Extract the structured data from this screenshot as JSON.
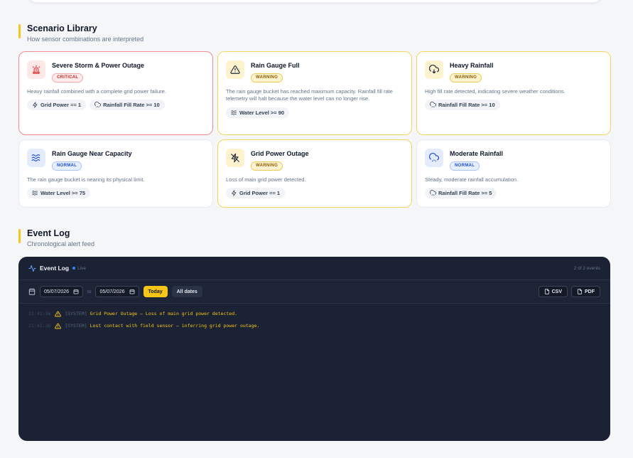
{
  "scenario_library": {
    "title": "Scenario Library",
    "subtitle": "How sensor combinations are interpreted",
    "cards": [
      {
        "title": "Severe Storm & Power Outage",
        "badge": "CRITICAL",
        "icon": "siren-icon",
        "desc": "Heavy rainfall combined with a complete grid power failure.",
        "chips": [
          "Grid Power == 1",
          "Rainfall Fill Rate >= 10"
        ]
      },
      {
        "title": "Rain Gauge Full",
        "badge": "WARNING",
        "icon": "alert-triangle-icon",
        "desc": "The rain gauge bucket has reached maximum capacity. Rainfall fill rate telemetry will halt because the water level can no longer rise.",
        "chips": [
          "Water Level >= 90"
        ]
      },
      {
        "title": "Heavy Rainfall",
        "badge": "WARNING",
        "icon": "cloud-rain-icon",
        "desc": "High fill rate detected, indicating severe weather conditions.",
        "chips": [
          "Rainfall Fill Rate >= 10"
        ]
      },
      {
        "title": "Rain Gauge Near Capacity",
        "badge": "NORMAL",
        "icon": "waves-icon",
        "desc": "The rain gauge bucket is nearing its physical limit.",
        "chips": [
          "Water Level >= 75"
        ]
      },
      {
        "title": "Grid Power Outage",
        "badge": "WARNING",
        "icon": "power-off-icon",
        "desc": "Loss of main grid power detected.",
        "chips": [
          "Grid Power == 1"
        ]
      },
      {
        "title": "Moderate Rainfall",
        "badge": "NORMAL",
        "icon": "cloud-drizzle-icon",
        "desc": "Steady, moderate rainfall accumulation.",
        "chips": [
          "Rainfall Fill Rate >= 5"
        ]
      }
    ]
  },
  "event_log_section": {
    "title": "Event Log",
    "subtitle": "Chronological alert feed"
  },
  "event_log": {
    "title": "Event Log",
    "live": "Live",
    "count": "2 of 2 events",
    "from_date": "05/07/2026",
    "to_label": "to",
    "to_date": "05/07/2026",
    "today_label": "Today",
    "all_dates_label": "All dates",
    "csv_label": "CSV",
    "pdf_label": "PDF",
    "entries": [
      {
        "time": "21:41:36",
        "source": "[SYSTEM]",
        "message": "Grid Power Outage — Loss of main grid power detected."
      },
      {
        "time": "21:41:36",
        "source": "[SYSTEM]",
        "message": "Lost contact with field sensor — inferring grid power outage."
      }
    ]
  },
  "colors": {
    "accent": "#f5c518",
    "critical": "#e53935",
    "warning": "#f5c518",
    "normal": "#2563eb",
    "log_bg": "#1b2233"
  }
}
